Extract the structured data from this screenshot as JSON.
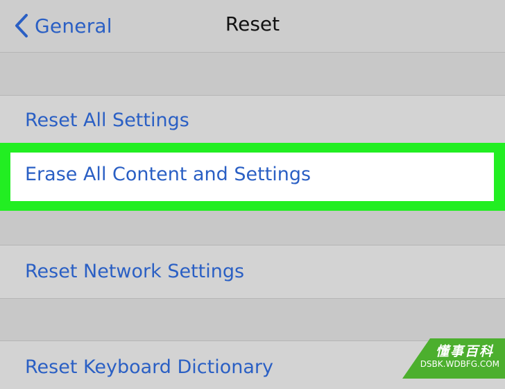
{
  "navbar": {
    "back_label": "General",
    "title": "Reset"
  },
  "rows": {
    "reset_all": "Reset All Settings",
    "erase_all": "Erase All Content and Settings",
    "reset_network": "Reset Network Settings",
    "reset_keyboard": "Reset Keyboard Dictionary"
  },
  "colors": {
    "link_blue": "#2a5fc4",
    "highlight_green": "#22ee22",
    "watermark_green": "#4caf2e"
  },
  "watermark": {
    "cn": "懂事百科",
    "en": "DSBK.WDBFG.COM"
  }
}
